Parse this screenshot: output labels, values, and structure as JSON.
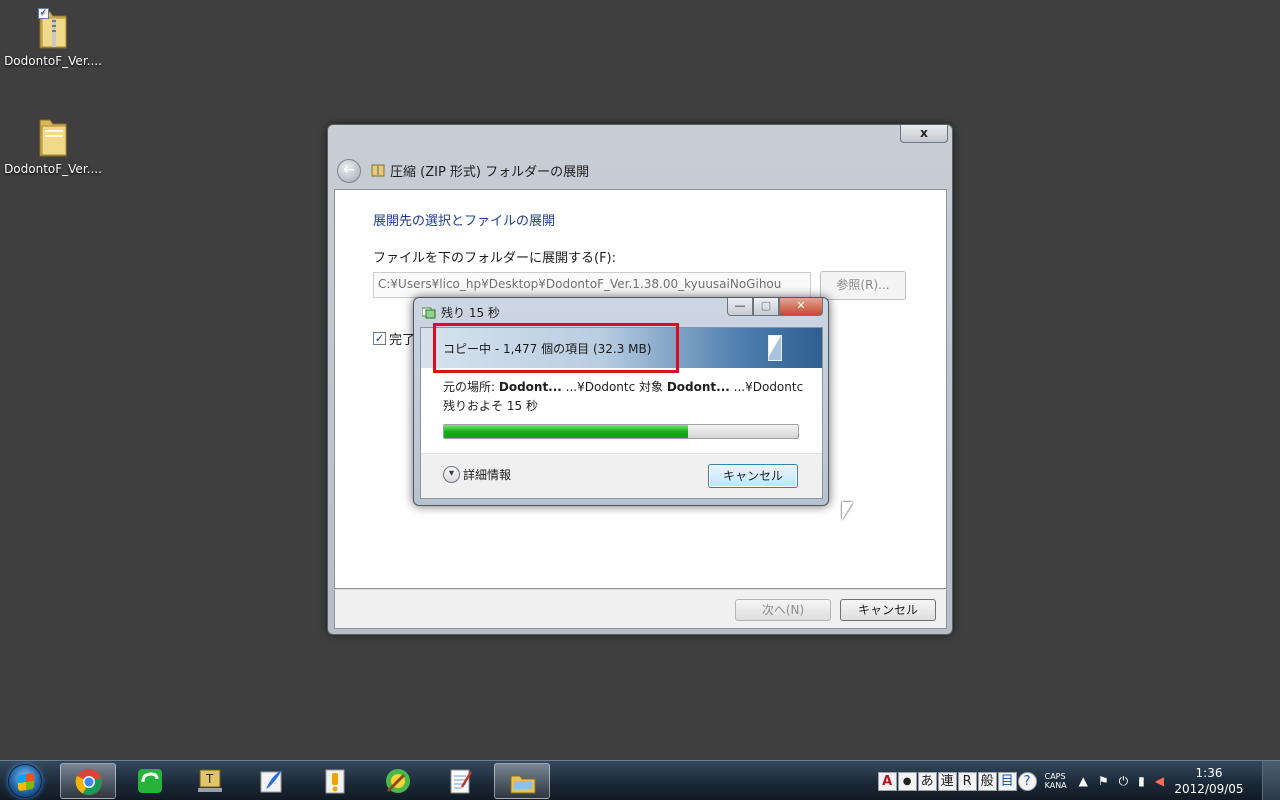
{
  "desktop": {
    "icons": [
      {
        "label": "DodontoF_Ver...."
      },
      {
        "label": "DodontoF_Ver...."
      }
    ]
  },
  "wizard": {
    "title": "圧縮 (ZIP 形式) フォルダーの展開",
    "close": "x",
    "heading": "展開先の選択とファイルの展開",
    "field_label": "ファイルを下のフォルダーに展開する(F):",
    "path_value": "C:¥Users¥lico_hp¥Desktop¥DodontoF_Ver.1.38.00_kyuusaiNoGihou",
    "browse_label": "参照(R)...",
    "show_files_label": "完了",
    "next_label": "次へ(N)",
    "cancel_label": "キャンセル"
  },
  "copy_dialog": {
    "title": "残り 15 秒",
    "status": "コピー中 - 1,477 個の項目 (32.3 MB)",
    "from_label": "元の場所: ",
    "from_name": "Dodont...",
    "from_path": "  ...¥Dodontc",
    "to_label": " 対象 ",
    "to_name": "Dodont...",
    "to_path": "  ...¥Dodontc",
    "remaining": "残りおよそ 15 秒",
    "progress": 0.69,
    "details_label": "詳細情報",
    "cancel_label": "キャンセル"
  },
  "taskbar": {
    "apps": [
      {
        "name": "chrome-icon"
      },
      {
        "name": "line-app-icon"
      },
      {
        "name": "text-editor-icon"
      },
      {
        "name": "feather-pen-icon"
      },
      {
        "name": "exclamation-doc-icon"
      },
      {
        "name": "paint-circle-icon"
      },
      {
        "name": "notepad-icon"
      },
      {
        "name": "explorer-folder-icon"
      }
    ],
    "ime": [
      "A",
      "●",
      "あ",
      "連",
      "R",
      "般",
      "目",
      "?"
    ],
    "caps_top": "CAPS",
    "caps_bottom": "KANA",
    "time": "1:36",
    "date": "2012/09/05"
  },
  "colors": {
    "desktop_bg": "#3f3f3f",
    "highlight_red": "#e00c1f",
    "progress_green": "#13b313",
    "link_blue": "#1e3d8f"
  }
}
